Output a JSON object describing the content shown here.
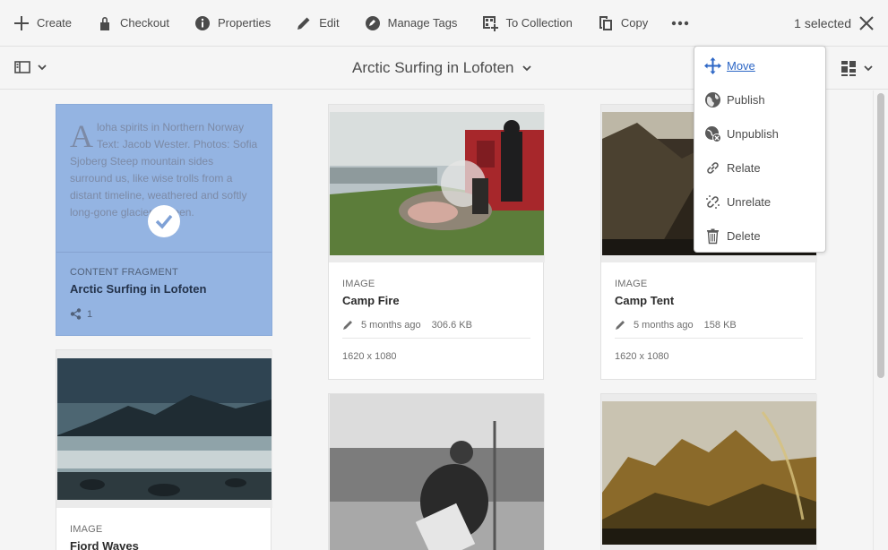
{
  "actionbar": {
    "actions": [
      {
        "label": "Create",
        "icon": "add-icon"
      },
      {
        "label": "Checkout",
        "icon": "lock-icon"
      },
      {
        "label": "Properties",
        "icon": "info-icon"
      },
      {
        "label": "Edit",
        "icon": "pencil-icon"
      },
      {
        "label": "Manage Tags",
        "icon": "tag-icon"
      },
      {
        "label": "To Collection",
        "icon": "collection-add-icon"
      },
      {
        "label": "Copy",
        "icon": "copy-icon"
      }
    ],
    "more_icon": "more-icon",
    "selection": "1 selected",
    "close_icon": "close-icon"
  },
  "titlebar": {
    "title": "Arctic Surfing in Lofoten",
    "rail_icon": "rail-toggle-icon",
    "view_icon": "card-view-icon"
  },
  "fragment": {
    "preview_dropcap": "A",
    "preview_text": "loha spirits in Northern Norway Text: Jacob Wester. Photos: Sofia Sjoberg Steep mountain sides surround us, like wise trolls from a distant timeline, weathered and softly long-gone glaciers, green.",
    "kind": "CONTENT FRAGMENT",
    "title": "Arctic Surfing in Lofoten",
    "references": "1"
  },
  "cards": [
    {
      "kind": "IMAGE",
      "title": "Camp Fire",
      "modified": "5 months ago",
      "size": "306.6 KB",
      "dims": "1620 x 1080"
    },
    {
      "kind": "IMAGE",
      "title": "Camp Tent",
      "modified": "5 months ago",
      "size": "158 KB",
      "dims": "1620 x 1080"
    },
    {
      "kind": "IMAGE",
      "title": "Fjord Waves"
    }
  ],
  "menu": {
    "items": [
      {
        "label": "Move",
        "icon": "move-icon"
      },
      {
        "label": "Publish",
        "icon": "globe-icon"
      },
      {
        "label": "Unpublish",
        "icon": "globe-remove-icon"
      },
      {
        "label": "Relate",
        "icon": "link-icon"
      },
      {
        "label": "Unrelate",
        "icon": "link-off-icon"
      },
      {
        "label": "Delete",
        "icon": "trash-icon"
      }
    ]
  },
  "colors": {
    "selection_bg": "#94b4e2",
    "menu_accent": "#2d67c6"
  }
}
